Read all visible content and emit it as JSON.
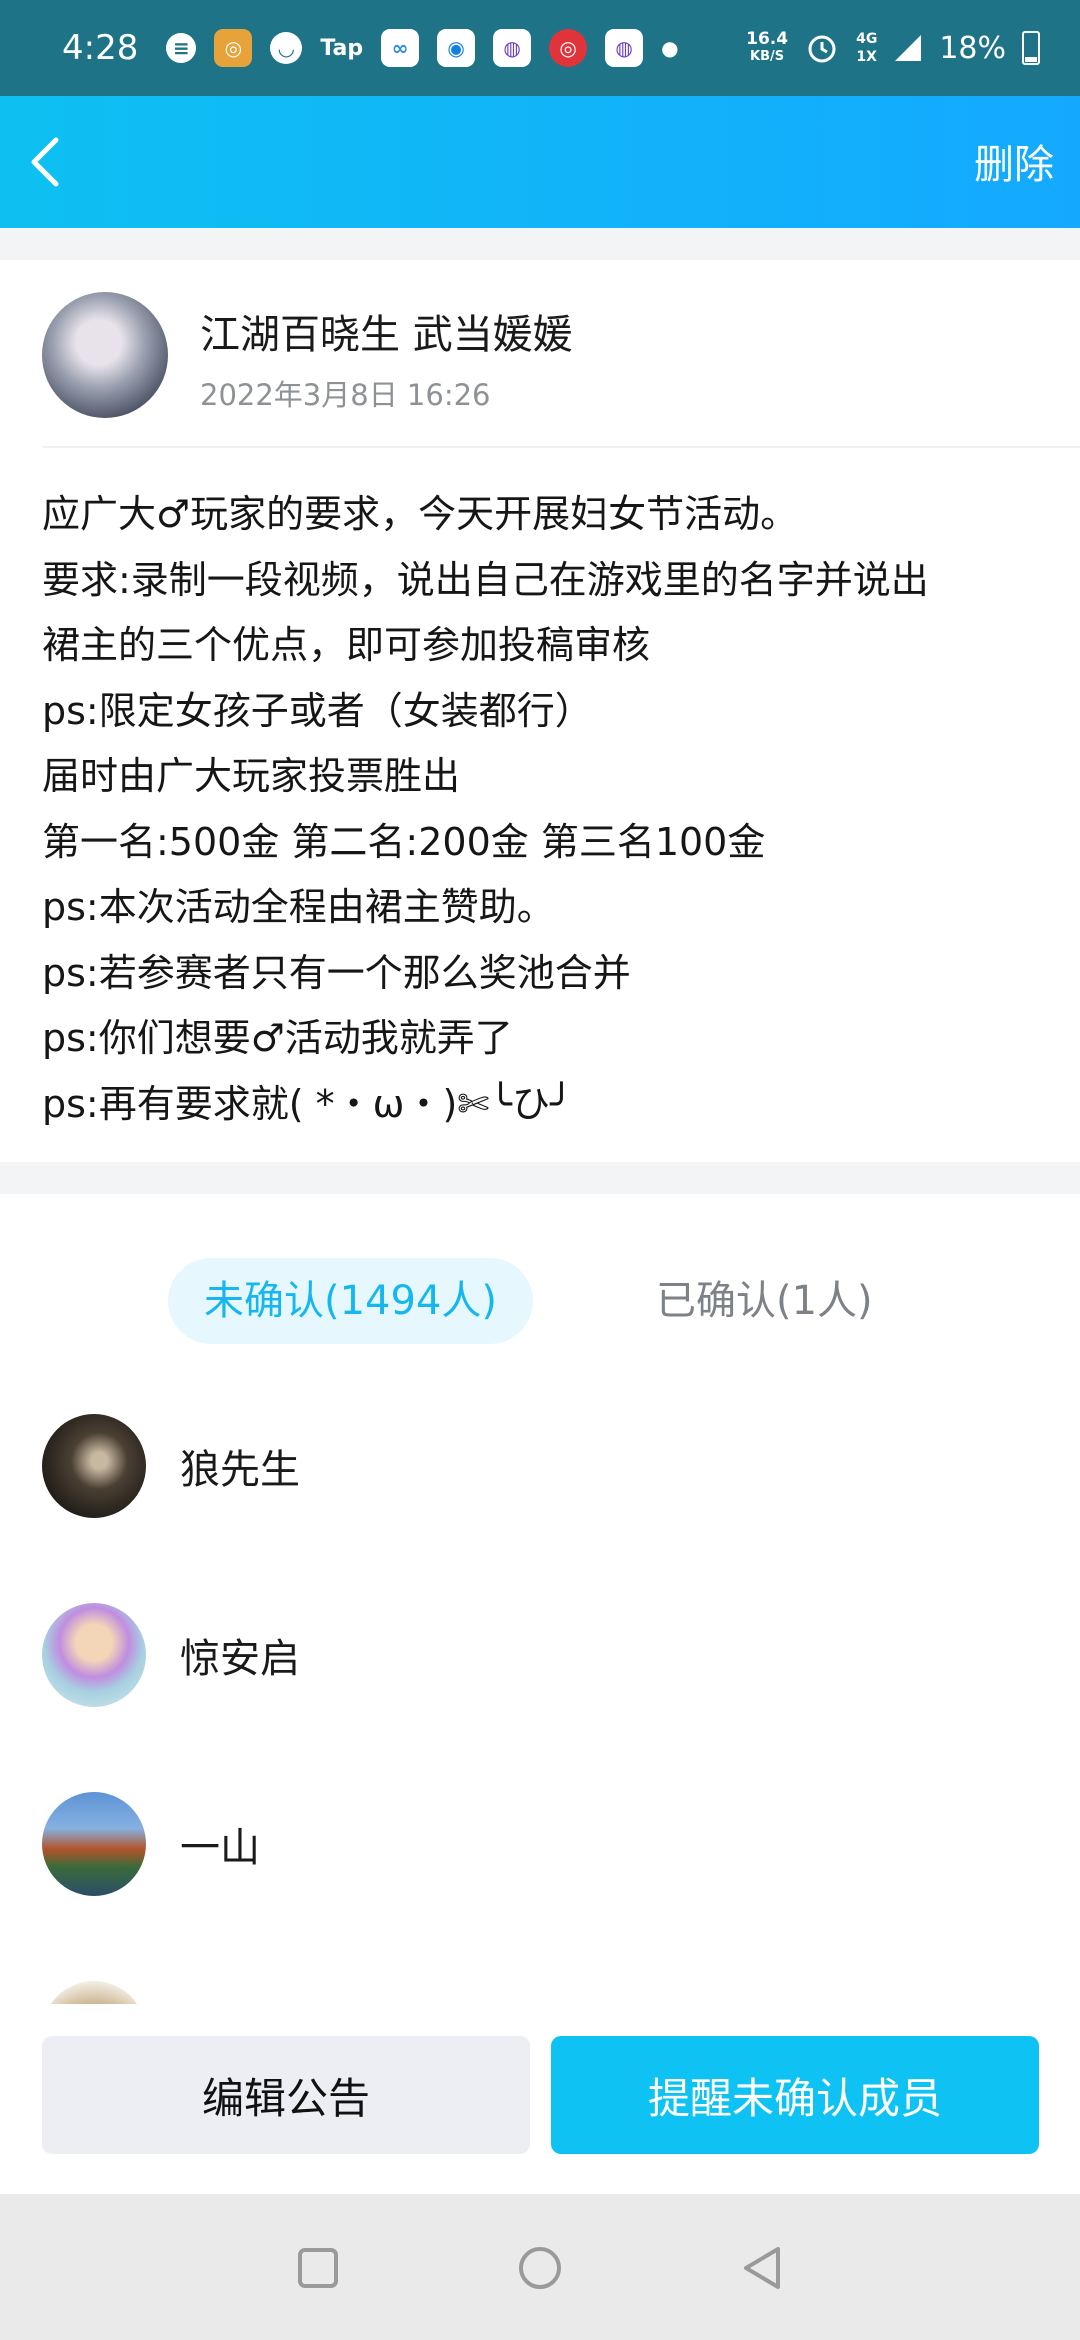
{
  "status_bar": {
    "time": "4:28",
    "speed_value": "16.4",
    "speed_unit": "KB/S",
    "network_top": "4G",
    "network_bottom": "1X",
    "battery": "18%"
  },
  "header": {
    "back_icon": "chevron-left-icon",
    "delete_label": "删除"
  },
  "post": {
    "author": "江湖百晓生 武当媛媛",
    "date": "2022年3月8日 16:26",
    "lines": [
      "应广大♂玩家的要求，今天开展妇女节活动。",
      "要求:录制一段视频，说出自己在游戏里的名字并说出",
      "裙主的三个优点，即可参加投稿审核",
      "ps:限定女孩子或者（女装都行）",
      "届时由广大玩家投票胜出",
      "第一名:500金 第二名:200金 第三名100金",
      "ps:本次活动全程由裙主赞助。",
      "ps:若参赛者只有一个那么奖池合并",
      "ps:你们想要♂活动我就弄了",
      "ps:再有要求就( *・ω・)✄╰ひ╯"
    ]
  },
  "tabs": {
    "unconfirmed": "未确认(1494人)",
    "confirmed": "已确认(1人)"
  },
  "members": [
    {
      "name": "狼先生"
    },
    {
      "name": "惊安启"
    },
    {
      "name": "一山"
    },
    {
      "name": ""
    }
  ],
  "actions": {
    "edit": "编辑公告",
    "remind": "提醒未确认成员"
  },
  "colors": {
    "accent": "#0ec2f4",
    "header_gradient_start": "#0ec0f2",
    "header_gradient_end": "#14a9ff",
    "status_bar": "#1e7387"
  }
}
